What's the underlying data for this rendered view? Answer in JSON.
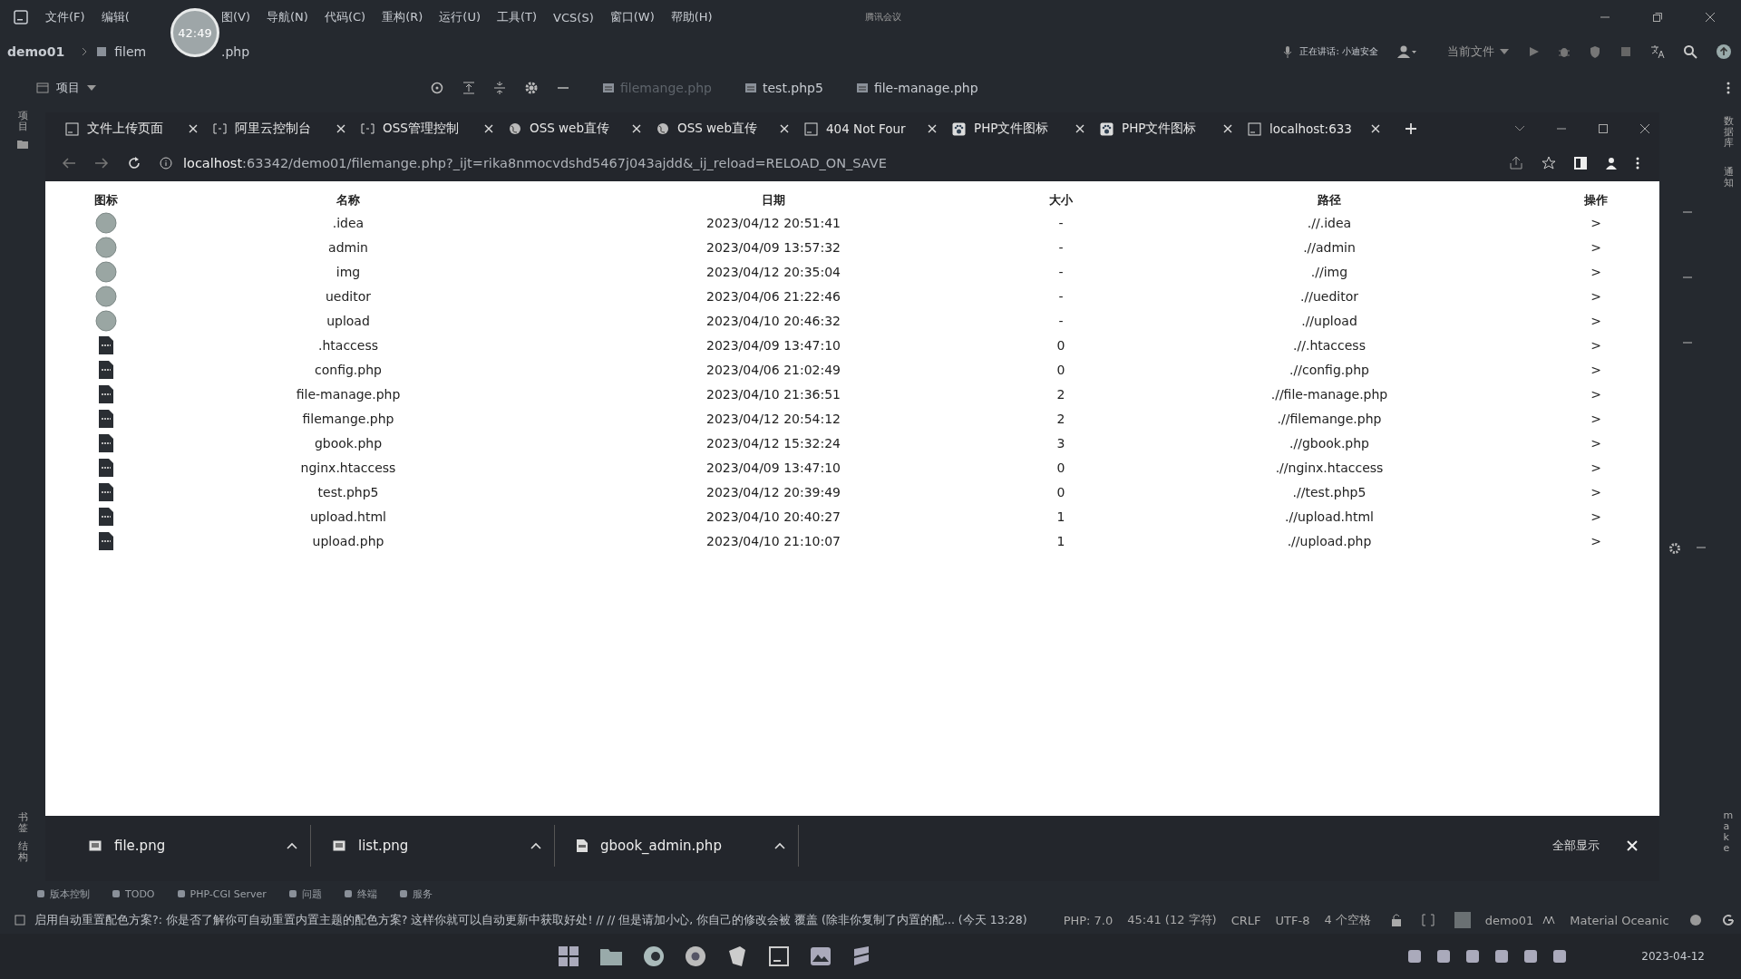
{
  "recording_timer": "42:49",
  "meeting_indicator": "腾讯会议",
  "menu": [
    "文件(F)",
    "编辑(",
    "图(V)",
    "导航(N)",
    "代码(C)",
    "重构(R)",
    "运行(U)",
    "工具(T)",
    "VCS(S)",
    "窗口(W)",
    "帮助(H)"
  ],
  "breadcrumb": [
    "demo01",
    "filem",
    ".php"
  ],
  "toolbar": {
    "speaking": "正在讲话: 小迪安全",
    "run_config": "当前文件"
  },
  "project_panel": {
    "title": "项目",
    "side_label": "项目"
  },
  "editor_tabs": [
    "filemange.php",
    "test.php5",
    "file-manage.php"
  ],
  "browser": {
    "tabs": [
      {
        "title": "文件上传页面",
        "kind": "ps"
      },
      {
        "title": "阿里云控制台",
        "kind": "console"
      },
      {
        "title": "OSS管理控制",
        "kind": "console"
      },
      {
        "title": "OSS web直传",
        "kind": "globe"
      },
      {
        "title": "OSS web直传",
        "kind": "globe"
      },
      {
        "title": "404 Not Four",
        "kind": "ps"
      },
      {
        "title": "PHP文件图标",
        "kind": "paw"
      },
      {
        "title": "PHP文件图标",
        "kind": "paw"
      },
      {
        "title": "localhost:633",
        "kind": "ps"
      }
    ],
    "url_host": "localhost",
    "url_rest": ":63342/demo01/filemange.php?_ijt=rika8nmocvdshd5467j043ajdd&_ij_reload=RELOAD_ON_SAVE"
  },
  "table": {
    "columns": [
      "图标",
      "名称",
      "日期",
      "大小",
      "路径",
      "操作"
    ],
    "rows": [
      {
        "kind": "folder",
        "name": ".idea",
        "date": "2023/04/12 20:51:41",
        "size": "-",
        "path": ".//.idea",
        "action": ">"
      },
      {
        "kind": "folder",
        "name": "admin",
        "date": "2023/04/09 13:57:32",
        "size": "-",
        "path": ".//admin",
        "action": ">"
      },
      {
        "kind": "folder",
        "name": "img",
        "date": "2023/04/12 20:35:04",
        "size": "-",
        "path": ".//img",
        "action": ">"
      },
      {
        "kind": "folder",
        "name": "ueditor",
        "date": "2023/04/06 21:22:46",
        "size": "-",
        "path": ".//ueditor",
        "action": ">"
      },
      {
        "kind": "folder",
        "name": "upload",
        "date": "2023/04/10 20:46:32",
        "size": "-",
        "path": ".//upload",
        "action": ">"
      },
      {
        "kind": "file",
        "name": ".htaccess",
        "date": "2023/04/09 13:47:10",
        "size": "0",
        "path": ".//.htaccess",
        "action": ">"
      },
      {
        "kind": "file",
        "name": "config.php",
        "date": "2023/04/06 21:02:49",
        "size": "0",
        "path": ".//config.php",
        "action": ">"
      },
      {
        "kind": "file",
        "name": "file-manage.php",
        "date": "2023/04/10 21:36:51",
        "size": "2",
        "path": ".//file-manage.php",
        "action": ">"
      },
      {
        "kind": "file",
        "name": "filemange.php",
        "date": "2023/04/12 20:54:12",
        "size": "2",
        "path": ".//filemange.php",
        "action": ">"
      },
      {
        "kind": "file",
        "name": "gbook.php",
        "date": "2023/04/12 15:32:24",
        "size": "3",
        "path": ".//gbook.php",
        "action": ">"
      },
      {
        "kind": "file",
        "name": "nginx.htaccess",
        "date": "2023/04/09 13:47:10",
        "size": "0",
        "path": ".//nginx.htaccess",
        "action": ">"
      },
      {
        "kind": "file",
        "name": "test.php5",
        "date": "2023/04/12 20:39:49",
        "size": "0",
        "path": ".//test.php5",
        "action": ">"
      },
      {
        "kind": "file",
        "name": "upload.html",
        "date": "2023/04/10 20:40:27",
        "size": "1",
        "path": ".//upload.html",
        "action": ">"
      },
      {
        "kind": "file",
        "name": "upload.php",
        "date": "2023/04/10 21:10:07",
        "size": "1",
        "path": ".//upload.php",
        "action": ">"
      }
    ]
  },
  "downloads": {
    "items": [
      {
        "name": "file.png",
        "kind": "image"
      },
      {
        "name": "list.png",
        "kind": "image"
      },
      {
        "name": "gbook_admin.php",
        "kind": "php"
      }
    ],
    "show_all": "全部显示"
  },
  "tool_tabs": [
    "版本控制",
    "TODO",
    "PHP-CGI Server",
    "问题",
    "终端",
    "服务"
  ],
  "status_bar": {
    "message": "启用自动重置配色方案?: 你是否了解你可自动重置内置主题的配色方案? 这样你就可以自动更新中获取好处! // // 但是请加小心, 你自己的修改会被 覆盖 (除非你复制了内置的配... (今天 13:28)",
    "items": [
      "PHP: 7.0",
      "45:41 (12 字符)",
      "CRLF",
      "UTF-8",
      "4 个空格"
    ],
    "project": "demo01",
    "theme": "Material Oceanic"
  },
  "left_strip": [
    "书签",
    "结构"
  ],
  "right_strip": [
    "数据库",
    "通知",
    "make"
  ],
  "taskbar": {
    "date": "2023-04-12"
  }
}
